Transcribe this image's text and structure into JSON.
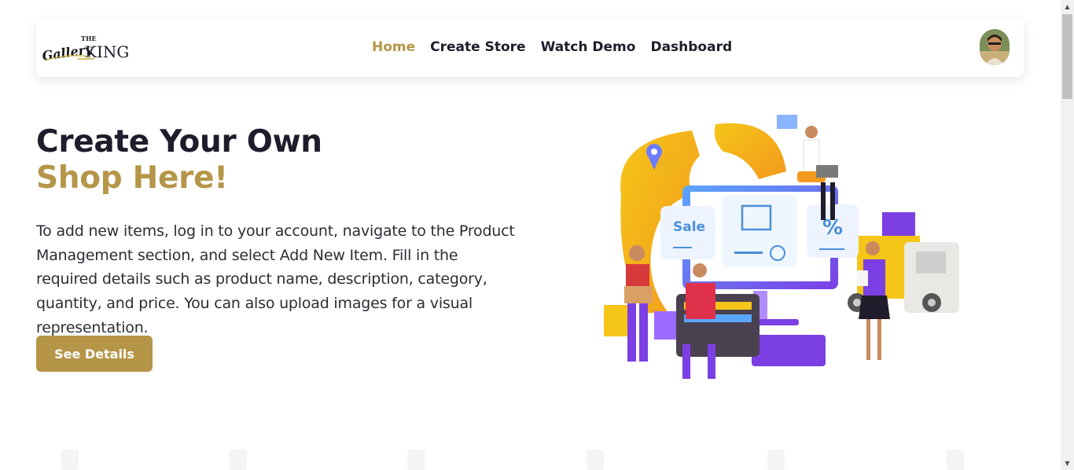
{
  "brand": {
    "logo_small": "THE",
    "logo_script": "Gallery",
    "logo_main": "KING"
  },
  "nav": {
    "items": [
      "Home",
      "Create Store",
      "Watch Demo",
      "Dashboard"
    ],
    "active_index": 0
  },
  "hero": {
    "title_line1": "Create Your Own",
    "title_line2": "Shop Here!",
    "description": "To add new items, log in to your account, navigate to the Product Management section, and select Add New Item. Fill in the required details such as product name, description, category, quantity, and price. You can also upload images for a visual representation.",
    "cta_label": "See Details"
  },
  "illustration": {
    "sale_label": "Sale",
    "percent_label": "%"
  },
  "colors": {
    "accent": "#b59548",
    "text_dark": "#1f1d2b",
    "purple": "#7b3fe4",
    "yellow": "#f5c518"
  },
  "icons": {
    "scroll_up": "▲",
    "scroll_down": "▼",
    "avatar": "user-avatar"
  }
}
